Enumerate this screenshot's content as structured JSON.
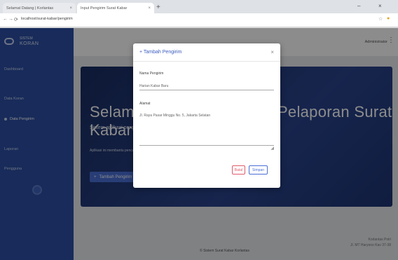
{
  "browser": {
    "tabs": [
      {
        "label": "Selamat Datang | Korlantas",
        "active": false
      },
      {
        "label": "Input Pengirim Surat Kabar",
        "active": true
      }
    ],
    "new_tab_glyph": "+",
    "url": "localhost/surat-kabar/pengirim",
    "nav": {
      "back": "←",
      "forward": "→",
      "reload": "⟳"
    }
  },
  "sidebar": {
    "brand_top": "SISTEM",
    "brand_bottom": "KORAN",
    "items": [
      {
        "label": "Dashboard",
        "active": false
      },
      {
        "label": "Data Koran",
        "active": false
      },
      {
        "label": "Data Pengirim",
        "active": true
      },
      {
        "label": "Laporan",
        "active": false
      },
      {
        "label": "Pengguna",
        "active": false
      }
    ]
  },
  "topbar": {
    "user": "Administrator"
  },
  "hero": {
    "title": "Selamat Datang di Sistem Pelaporan Surat Kabar Korlantas",
    "subtitle": "Sistem aplikasi pengelolaan data surat kabar dan pengirim di Korlantas Polri",
    "description": "Aplikasi ini membantu pencatatan data pengirim serta pelaporan surat kabar yang masuk setiap harinya",
    "button": "Tambah Pengirim"
  },
  "footer": {
    "left": "© Sistem Surat Kabar Korlantas",
    "right_1": "Korlantas Polri",
    "right_2": "Jl. MT Haryono Kav 37-38"
  },
  "modal": {
    "title": "Tambah Pengirim",
    "close": "×",
    "fields": [
      {
        "label": "Nama Pengirim",
        "value": "Harian Kabar Baru"
      },
      {
        "label": "Alamat",
        "value": "Jl. Raya Pasar Minggu No. 5, Jakarta Selatan"
      }
    ],
    "cancel": "Batal",
    "save": "Simpan"
  },
  "colors": {
    "sidebar": "#2c4fa4",
    "accent": "#4a6fd8",
    "danger": "#e05b6a",
    "hero": "#1d3574"
  },
  "icons": [
    "menu-icon",
    "user-icon",
    "plus-icon",
    "close-icon",
    "back-icon",
    "forward-icon",
    "reload-icon"
  ]
}
